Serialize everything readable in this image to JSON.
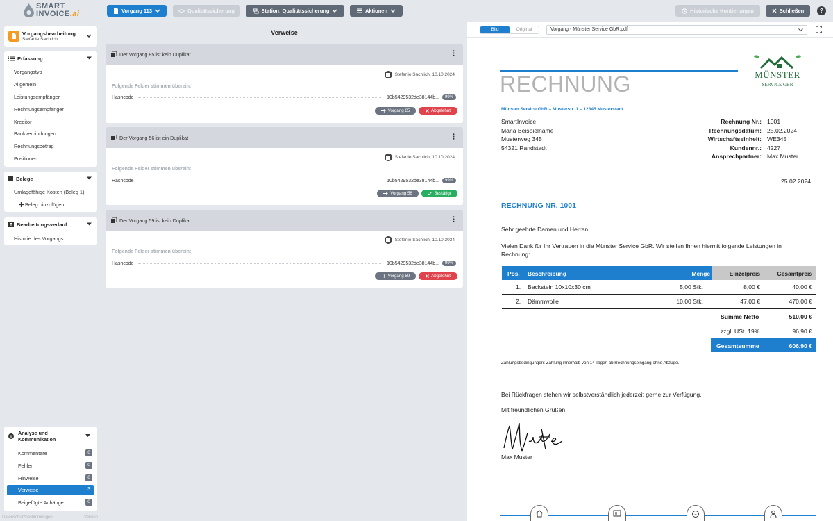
{
  "app": {
    "logo_line1": "SMART",
    "logo_line2": "INVOICE",
    "logo_suffix": ".ai"
  },
  "toolbar": {
    "vorgang": "Vorgang 113",
    "qs": "Qualitätssicherung",
    "station": "Station: Qualitätssicherung",
    "aktionen": "Aktionen",
    "historische": "Historische Kontierungen",
    "schliessen": "Schließen",
    "help": "?"
  },
  "sidebar": {
    "header_title": "Vorgangsbearbeitung",
    "header_sub": "Stefanie Sachlich",
    "erfassung": {
      "title": "Erfassung",
      "items": [
        "Vorgangstyp",
        "Allgemein",
        "Leistungsempfänger",
        "Rechnungsempfänger",
        "Kreditor",
        "Bankverbindungen",
        "Rechnungsbetrag",
        "Positionen"
      ]
    },
    "belege": {
      "title": "Belege",
      "items": [
        "Umlagefähige Kosten (Beleg 1)"
      ],
      "add": "Beleg hinzufügen"
    },
    "verlauf": {
      "title": "Bearbeitungsverlauf",
      "items": [
        "Historie des Vorgangs"
      ]
    },
    "analyse": {
      "title_line1": "Analyse und",
      "title_line2": "Kommunikation",
      "items": [
        {
          "label": "Kommentare",
          "count": "0"
        },
        {
          "label": "Fehler",
          "count": "0"
        },
        {
          "label": "Hinweise",
          "count": "0"
        },
        {
          "label": "Verweise",
          "count": "3"
        },
        {
          "label": "Beigefügte Anhänge",
          "count": "0"
        }
      ]
    },
    "footer_left": "Datenschutzbestimmungen",
    "footer_right": "Version"
  },
  "verweise": {
    "title": "Verweise",
    "cards": [
      {
        "head": "Der Vorgang 85 ist kein Duplikat",
        "meta": "Stefanie Sachlich, 10.10.2024",
        "sub": "Folgende Felder stimmen überein:",
        "field": "Hashcode",
        "value": "10b5429532de38144b...",
        "pct": "99%",
        "link": "Vorgang 85",
        "status": "Abgelehnt",
        "status_type": "r"
      },
      {
        "head": "Der Vorgang 56 ist ein Duplikat",
        "meta": "Stefanie Sachlich, 10.10.2024",
        "sub": "Folgende Felder stimmen überein:",
        "field": "Hashcode",
        "value": "10b5429532de38144b...",
        "pct": "99%",
        "link": "Vorgang 56",
        "status": "Bestätigt",
        "status_type": "gr"
      },
      {
        "head": "Der Vorgang 59 ist kein Duplikat",
        "meta": "Stefanie Sachlich, 10.10.2024",
        "sub": "Folgende Felder stimmen überein:",
        "field": "Hashcode",
        "value": "10b5429532de38144b...",
        "pct": "99%",
        "link": "Vorgang 59",
        "status": "Abgelehnt",
        "status_type": "r"
      }
    ]
  },
  "viewer": {
    "tab_bild": "Bild",
    "tab_original": "Original",
    "file": "Vorgang - Münster Service GbR.pdf"
  },
  "invoice": {
    "title": "RECHNUNG",
    "logo_name": "MÜNSTER",
    "logo_sub": "SERVICE GBR",
    "sender_line": "Münster Service GbR – Musterstr. 1 – 12345 Musterstadt",
    "recipient": [
      "SmartInvoice",
      "Maria Beispielname",
      "Musterweg 345",
      "54321 Randstadt"
    ],
    "meta": [
      {
        "k": "Rechnung Nr.:",
        "v": "1001"
      },
      {
        "k": "Rechnungsdatum:",
        "v": "25.02.2024"
      },
      {
        "k": "Wirtschaftseinheit:",
        "v": "WE345"
      },
      {
        "k": "Kundennr.:",
        "v": "4227"
      },
      {
        "k": "Ansprechpartner:",
        "v": "Max Muster"
      }
    ],
    "date": "25.02.2024",
    "heading": "RECHNUNG NR. 1001",
    "greeting": "Sehr geehrte Damen und Herren,",
    "intro": "Vielen Dank für Ihr Vertrauen in die Münster Service GbR. Wir stellen Ihnen hiermit folgende Leistungen in Rechnung:",
    "table_head": [
      "Pos.",
      "Beschreibung",
      "Menge",
      "Einzelpreis",
      "Gesamtpreis"
    ],
    "rows": [
      [
        "1.",
        "Backstein 10x10x30 cm",
        "5,00 Stk.",
        "8,00 €",
        "40,00 €"
      ],
      [
        "2.",
        "Dämmwolle",
        "10,00 Stk.",
        "47,00 €",
        "470,00 €"
      ]
    ],
    "summe_netto_label": "Summe Netto",
    "summe_netto": "510,00 €",
    "ust_label": "zzgl. USt. 19%",
    "ust": "96,90 €",
    "gesamt_label": "Gesamtsumme",
    "gesamt": "606,90 €",
    "terms": "Zahlungsbedingungen: Zahlung innerhalb von 14 Tagen ab Rechnungseingang ohne Abzüge.",
    "closing1": "Bei Rückfragen stehen wir selbstverständlich jederzeit gerne zur Verfügung.",
    "closing2": "Mit freundlichen Grüßen",
    "signature": "M. Muster",
    "signer": "Max Muster"
  },
  "colors": {
    "accent": "#1f7fcf",
    "danger": "#e0434b",
    "success": "#27ae60",
    "logo_orange": "#f59a23",
    "brand_green": "#2e8b3a"
  }
}
